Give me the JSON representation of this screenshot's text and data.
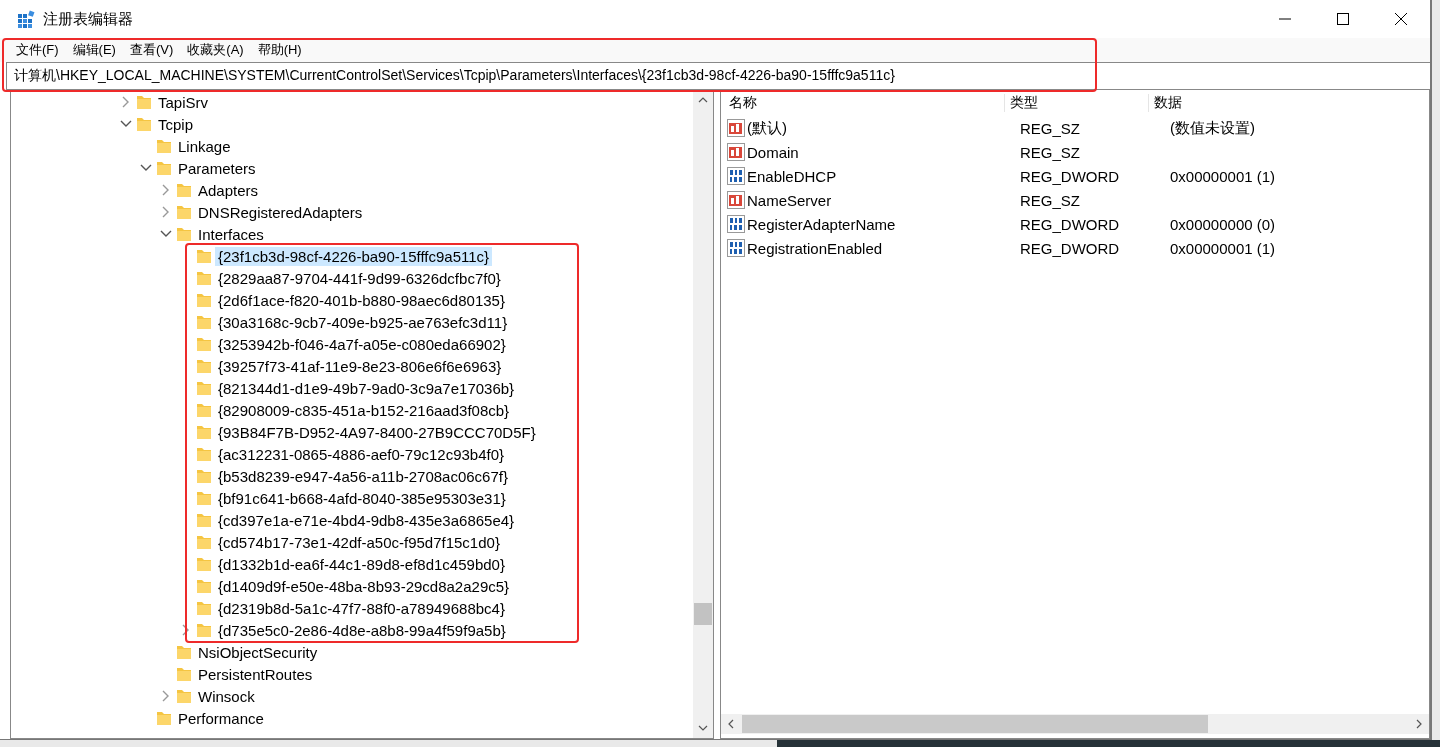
{
  "window": {
    "title": "注册表编辑器"
  },
  "menu": [
    {
      "label": "文件(F)"
    },
    {
      "label": "编辑(E)"
    },
    {
      "label": "查看(V)"
    },
    {
      "label": "收藏夹(A)"
    },
    {
      "label": "帮助(H)"
    }
  ],
  "address": "计算机\\HKEY_LOCAL_MACHINE\\SYSTEM\\CurrentControlSet\\Services\\Tcpip\\Parameters\\Interfaces\\{23f1cb3d-98cf-4226-ba90-15fffc9a511c}",
  "tree": [
    {
      "label": "TapiSrv",
      "expanded": false,
      "selected": false
    },
    {
      "label": "Tcpip",
      "expanded": true,
      "selected": false,
      "children": [
        {
          "label": "Linkage",
          "selected": false
        },
        {
          "label": "Parameters",
          "expanded": true,
          "selected": false,
          "children": [
            {
              "label": "Adapters",
              "expanded": false,
              "selected": false
            },
            {
              "label": "DNSRegisteredAdapters",
              "expanded": false,
              "selected": false
            },
            {
              "label": "Interfaces",
              "expanded": true,
              "selected": false,
              "children": [
                {
                  "label": "{23f1cb3d-98cf-4226-ba90-15fffc9a511c}",
                  "selected": true
                },
                {
                  "label": "{2829aa87-9704-441f-9d99-6326dcfbc7f0}",
                  "selected": false
                },
                {
                  "label": "{2d6f1ace-f820-401b-b880-98aec6d80135}",
                  "selected": false
                },
                {
                  "label": "{30a3168c-9cb7-409e-b925-ae763efc3d11}",
                  "selected": false
                },
                {
                  "label": "{3253942b-f046-4a7f-a05e-c080eda66902}",
                  "selected": false
                },
                {
                  "label": "{39257f73-41af-11e9-8e23-806e6f6e6963}",
                  "selected": false
                },
                {
                  "label": "{821344d1-d1e9-49b7-9ad0-3c9a7e17036b}",
                  "selected": false
                },
                {
                  "label": "{82908009-c835-451a-b152-216aad3f08cb}",
                  "selected": false
                },
                {
                  "label": "{93B84F7B-D952-4A97-8400-27B9CCC70D5F}",
                  "selected": false
                },
                {
                  "label": "{ac312231-0865-4886-aef0-79c12c93b4f0}",
                  "selected": false
                },
                {
                  "label": "{b53d8239-e947-4a56-a11b-2708ac06c67f}",
                  "selected": false
                },
                {
                  "label": "{bf91c641-b668-4afd-8040-385e95303e31}",
                  "selected": false
                },
                {
                  "label": "{cd397e1a-e71e-4bd4-9db8-435e3a6865e4}",
                  "selected": false
                },
                {
                  "label": "{cd574b17-73e1-42df-a50c-f95d7f15c1d0}",
                  "selected": false
                },
                {
                  "label": "{d1332b1d-ea6f-44c1-89d8-ef8d1c459bd0}",
                  "selected": false
                },
                {
                  "label": "{d1409d9f-e50e-48ba-8b93-29cd8a2a29c5}",
                  "selected": false
                },
                {
                  "label": "{d2319b8d-5a1c-47f7-88f0-a78949688bc4}",
                  "selected": false
                },
                {
                  "label": "{d735e5c0-2e86-4d8e-a8b8-99a4f59f9a5b}",
                  "expanded": false,
                  "selected": false
                }
              ]
            },
            {
              "label": "NsiObjectSecurity",
              "selected": false
            },
            {
              "label": "PersistentRoutes",
              "selected": false
            },
            {
              "label": "Winsock",
              "expanded": false,
              "selected": false
            }
          ]
        },
        {
          "label": "Performance",
          "selected": false
        }
      ]
    }
  ],
  "values": {
    "columns": [
      "名称",
      "类型",
      "数据"
    ],
    "rows": [
      {
        "kind": "sz",
        "name": "(默认)",
        "type": "REG_SZ",
        "data": "(数值未设置)"
      },
      {
        "kind": "sz",
        "name": "Domain",
        "type": "REG_SZ"
      },
      {
        "kind": "dword",
        "name": "EnableDHCP",
        "type": "REG_DWORD",
        "data": "0x00000001 (1)"
      },
      {
        "kind": "sz",
        "name": "NameServer",
        "type": "REG_SZ"
      },
      {
        "kind": "dword",
        "name": "RegisterAdapterName",
        "type": "REG_DWORD",
        "data": "0x00000000 (0)"
      },
      {
        "kind": "dword",
        "name": "RegistrationEnabled",
        "type": "REG_DWORD",
        "data": "0x00000001 (1)"
      }
    ]
  }
}
